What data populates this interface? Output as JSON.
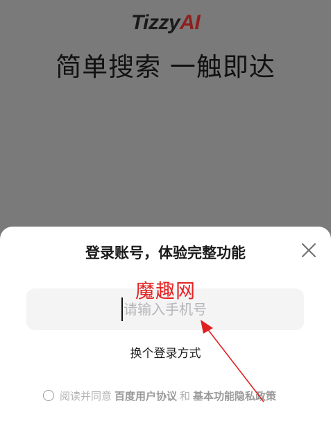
{
  "header": {
    "brand_prefix": "Tizzy",
    "brand_suffix": "AI",
    "slogan": "简单搜索 一触即达"
  },
  "login_sheet": {
    "title": "登录账号，体验完整功能",
    "close_icon": "close-icon",
    "phone_placeholder": "请输入手机号",
    "phone_value": "",
    "switch_method_label": "换个登录方式",
    "agreement": {
      "prefix": "阅读并同意",
      "user_agreement": "百度用户协议",
      "conjunction": "和",
      "privacy_policy": "基本功能隐私政策"
    }
  },
  "overlay": {
    "watermark": "魔趣网"
  },
  "colors": {
    "backdrop": "#7a7a7a",
    "brand_accent": "#8e1f1f",
    "watermark": "#e52424"
  }
}
